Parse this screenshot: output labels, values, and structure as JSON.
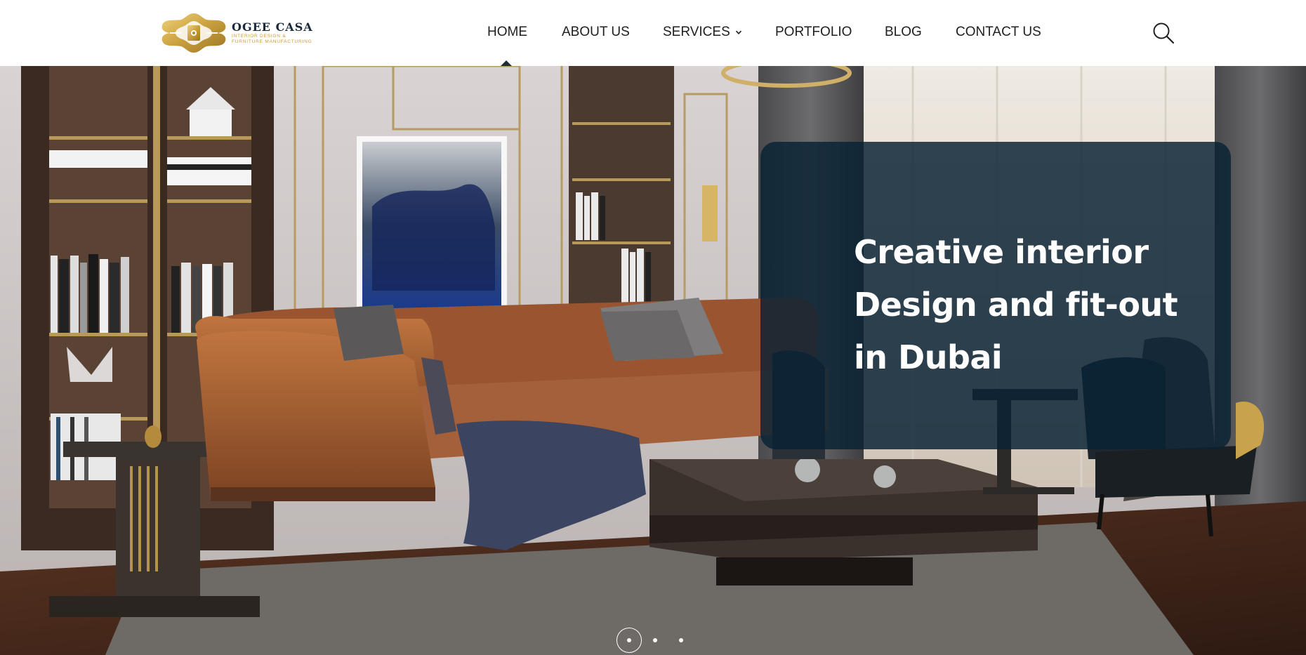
{
  "brand": {
    "name": "OGEE CASA",
    "tagline_line1": "INTERIOR DESIGN &",
    "tagline_line2": "FURNITURE MANUFACTURING",
    "logo_icon": "ogee-casa-logo-mark",
    "gold": "#c79b38",
    "navy": "#1b2a3a"
  },
  "nav": {
    "items": [
      {
        "label": "HOME",
        "active": true
      },
      {
        "label": "ABOUT US"
      },
      {
        "label": "SERVICES",
        "has_dropdown": true,
        "dropdown_icon": "chevron-down-icon"
      },
      {
        "label": "PORTFOLIO"
      },
      {
        "label": "BLOG"
      },
      {
        "label": "CONTACT US"
      }
    ],
    "search_icon": "search-icon"
  },
  "hero": {
    "caption_lines": [
      "Creative interior",
      "Design and fit-out",
      "in Dubai"
    ],
    "caption_bg": "#0a2234",
    "slides": {
      "count": 3,
      "active_index": 0
    }
  }
}
